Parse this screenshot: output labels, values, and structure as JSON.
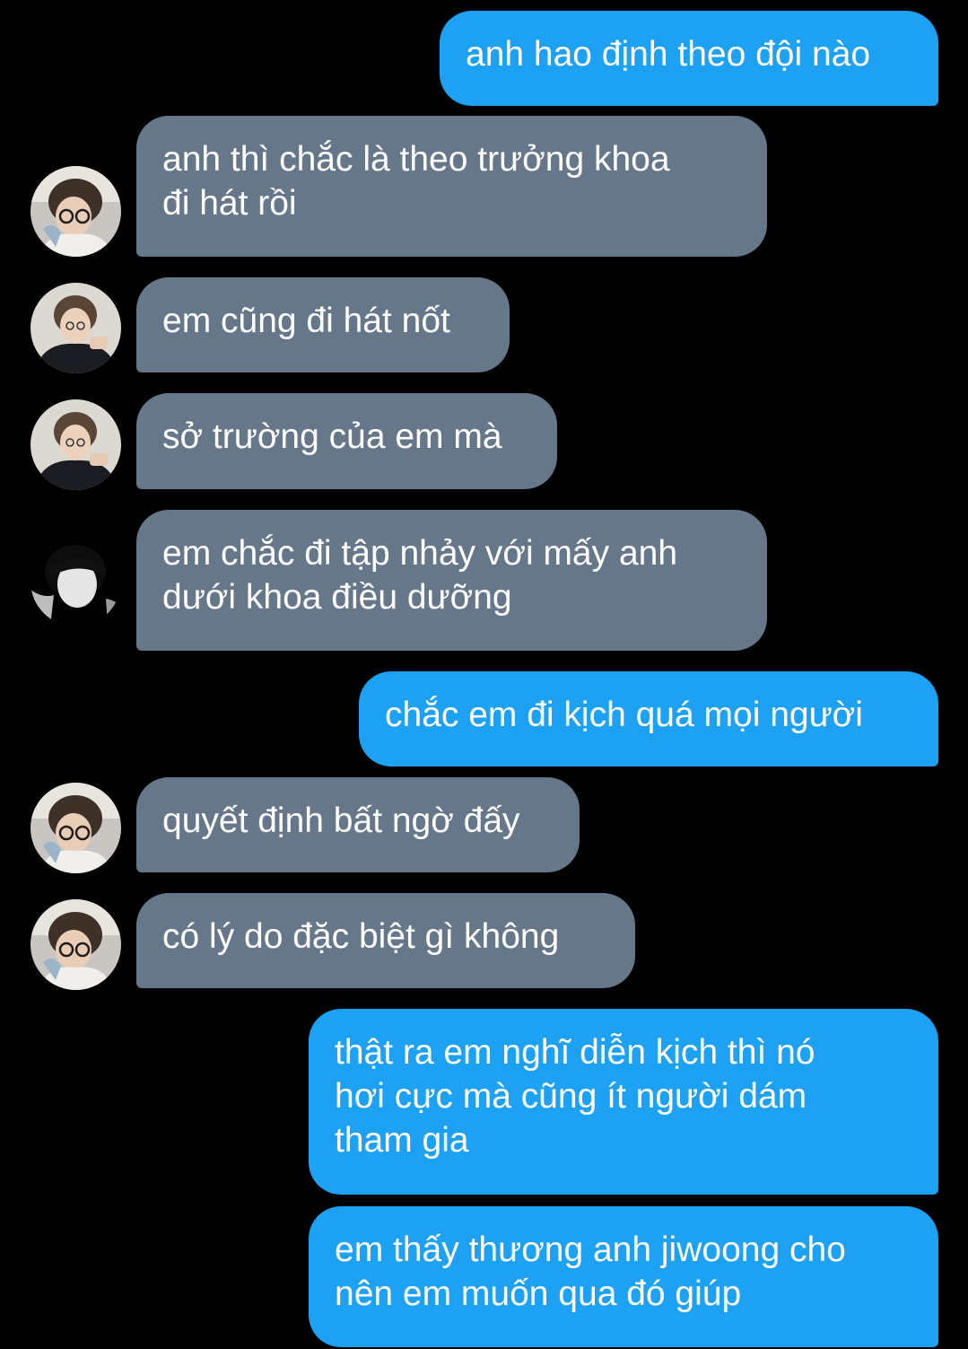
{
  "chat": {
    "messages": [
      {
        "side": "out",
        "text": "anh hao định theo đội nào"
      },
      {
        "side": "in",
        "avatar": "avatar-light-hoodie-glasses",
        "text": "anh thì chắc là theo trưởng khoa\nđi hát rồi"
      },
      {
        "side": "in",
        "avatar": "avatar-dark-suit",
        "text": "em cũng đi hát nốt"
      },
      {
        "side": "in",
        "avatar": "avatar-dark-suit",
        "text": "sở trường của em mà"
      },
      {
        "side": "in",
        "avatar": "avatar-monochrome",
        "text": "em chắc đi tập nhảy với mấy anh\ndưới khoa điều dưỡng"
      },
      {
        "side": "out",
        "text": "chắc em đi kịch quá mọi người"
      },
      {
        "side": "in",
        "avatar": "avatar-light-hoodie-glasses",
        "text": "quyết định bất ngờ đấy"
      },
      {
        "side": "in",
        "avatar": "avatar-light-hoodie-glasses",
        "text": "có lý do đặc biệt gì không"
      },
      {
        "side": "out",
        "text": "thật ra em nghĩ diễn kịch thì nó\nhơi cực mà cũng ít người dám\ntham gia"
      },
      {
        "side": "out",
        "text": "em thấy thương anh jiwoong cho\nnên em muốn qua đó giúp"
      }
    ]
  },
  "colors": {
    "background": "#000000",
    "outgoing_bubble": "#1da1f2",
    "incoming_bubble": "#66778a",
    "text": "#ffffff"
  }
}
